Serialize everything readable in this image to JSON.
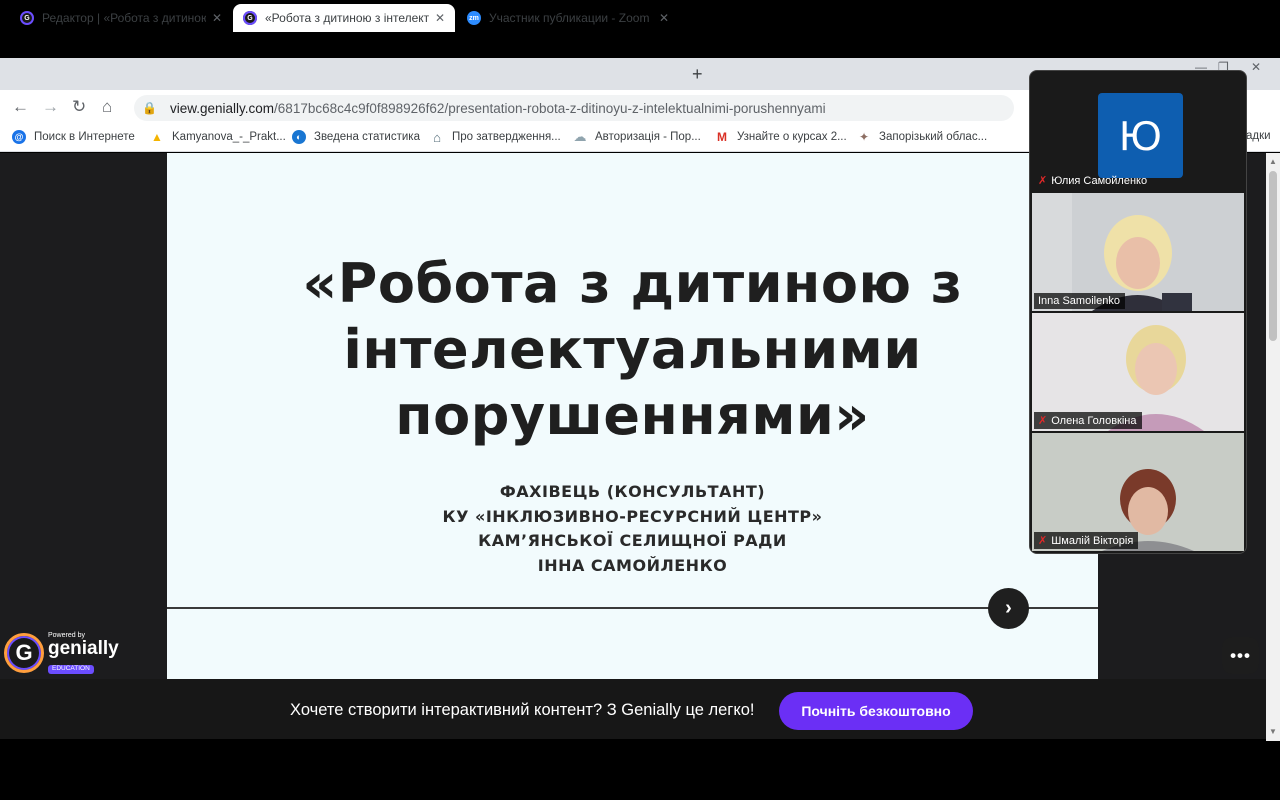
{
  "browser": {
    "tabs": [
      {
        "title": "Редактор | «Робота з дитиною з",
        "close": "✕",
        "favicon": "genially-icon"
      },
      {
        "title": "«Робота з дитиною з інтелекту",
        "close": "✕",
        "favicon": "genially-icon"
      },
      {
        "title": "Участник публикации - Zoom",
        "close": "✕",
        "favicon": "zoom-icon",
        "favicon_text": "zm"
      }
    ],
    "new_tab": "+",
    "window_controls": [
      "—",
      "❐",
      "✕"
    ],
    "nav": {
      "back": "←",
      "forward": "→",
      "reload": "↻",
      "home": "⌂"
    },
    "url": {
      "lock": "🔒",
      "host": "view.genially.com",
      "path": "/6817bc68c4c9f0f898926f62/presentation-robota-z-ditinoyu-z-intelektualnimi-porushennyami"
    },
    "bookmarks": [
      {
        "label": "Поиск в Интернете",
        "icon": "at-icon",
        "glyph": "@",
        "color": "#1a73e8"
      },
      {
        "label": "Kamyanova_-_Prakt...",
        "icon": "drive-icon",
        "glyph": "▲",
        "color": "#f4b400"
      },
      {
        "label": "Зведена статистика",
        "icon": "globe-icon",
        "glyph": "◐",
        "color": "#1976d2"
      },
      {
        "label": "Про затвердження...",
        "icon": "building-icon",
        "glyph": "⌂",
        "color": "#546e7a"
      },
      {
        "label": "Авторизація - Пор...",
        "icon": "cloud-icon",
        "glyph": "☁",
        "color": "#90a4ae"
      },
      {
        "label": "Узнайте о курсах 2...",
        "icon": "gmail-icon",
        "glyph": "M",
        "color": "#d93025"
      },
      {
        "label": "Запорізький облас...",
        "icon": "emblem-icon",
        "glyph": "✦",
        "color": "#8d6e63"
      }
    ],
    "bookmarks_more": "адки"
  },
  "slide": {
    "title": "«Робота з дитиною з інтелектуальними порушеннями»",
    "title_lines": [
      "«Робота з дитиною з",
      "інтелектуальними",
      "порушеннями»"
    ],
    "subtitle_lines": [
      "ФАХІВЕЦЬ (КОНСУЛЬТАНТ)",
      "КУ «ІНКЛЮЗИВНО-РЕСУРСНИЙ ЦЕНТР»",
      "КАМ’ЯНСЬКОЇ СЕЛИЩНОЇ РАДИ",
      "ІННА САМОЙЛЕНКО"
    ],
    "next": "›"
  },
  "genially": {
    "powered": "Powered by",
    "name": "genially",
    "edu": "EDUCATION",
    "mark": "G"
  },
  "promo": {
    "text": "Хочете створити інтерактивний контент? З Genially це легко!",
    "button": "Почніть безкоштовно"
  },
  "more_button": "•••",
  "zoom": {
    "participants": [
      {
        "name": "Юлия Самойленко",
        "avatar_letter": "Ю",
        "muted": true,
        "video": false,
        "active_speaker": false
      },
      {
        "name": "Inna Samoilenko",
        "muted": false,
        "video": true,
        "active_speaker": true
      },
      {
        "name": "Олена Головкіна",
        "muted": true,
        "video": true,
        "active_speaker": false
      },
      {
        "name": "Шмалій Вікторія",
        "muted": true,
        "video": true,
        "active_speaker": false
      }
    ],
    "mute_icon": "🎤"
  },
  "colors": {
    "accent": "#6b2ff5",
    "active_speaker": "#23d160",
    "zoom_avatar": "#0e5eb0",
    "slide_bg": "#f2fbfd"
  }
}
